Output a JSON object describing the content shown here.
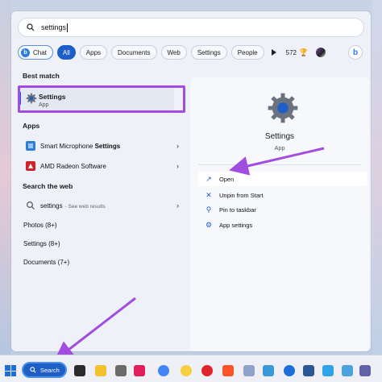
{
  "search": {
    "query": "settings"
  },
  "chips": {
    "chat": "Chat",
    "all": "All",
    "apps": "Apps",
    "documents": "Documents",
    "web": "Web",
    "settings": "Settings",
    "people": "People",
    "count": "572"
  },
  "left": {
    "best_match_header": "Best match",
    "best_match_title": "Settings",
    "best_match_sub": "App",
    "apps_header": "Apps",
    "apps": [
      {
        "prefix": "Smart Microphone ",
        "bold": "Settings"
      },
      {
        "prefix": "AMD Radeon Software",
        "bold": ""
      }
    ],
    "web_header": "Search the web",
    "web_query": "settings",
    "web_sub": "- See web results",
    "photos": "Photos (8+)",
    "settings_more": "Settings (8+)",
    "documents": "Documents (7+)"
  },
  "preview": {
    "title": "Settings",
    "sub": "App",
    "actions": [
      "Open",
      "Unpin from Start",
      "Pin to taskbar",
      "App settings"
    ]
  },
  "taskbar": {
    "search_label": "Search"
  },
  "colors": {
    "accent": "#1e5ec7",
    "annotation": "#a04de0"
  }
}
